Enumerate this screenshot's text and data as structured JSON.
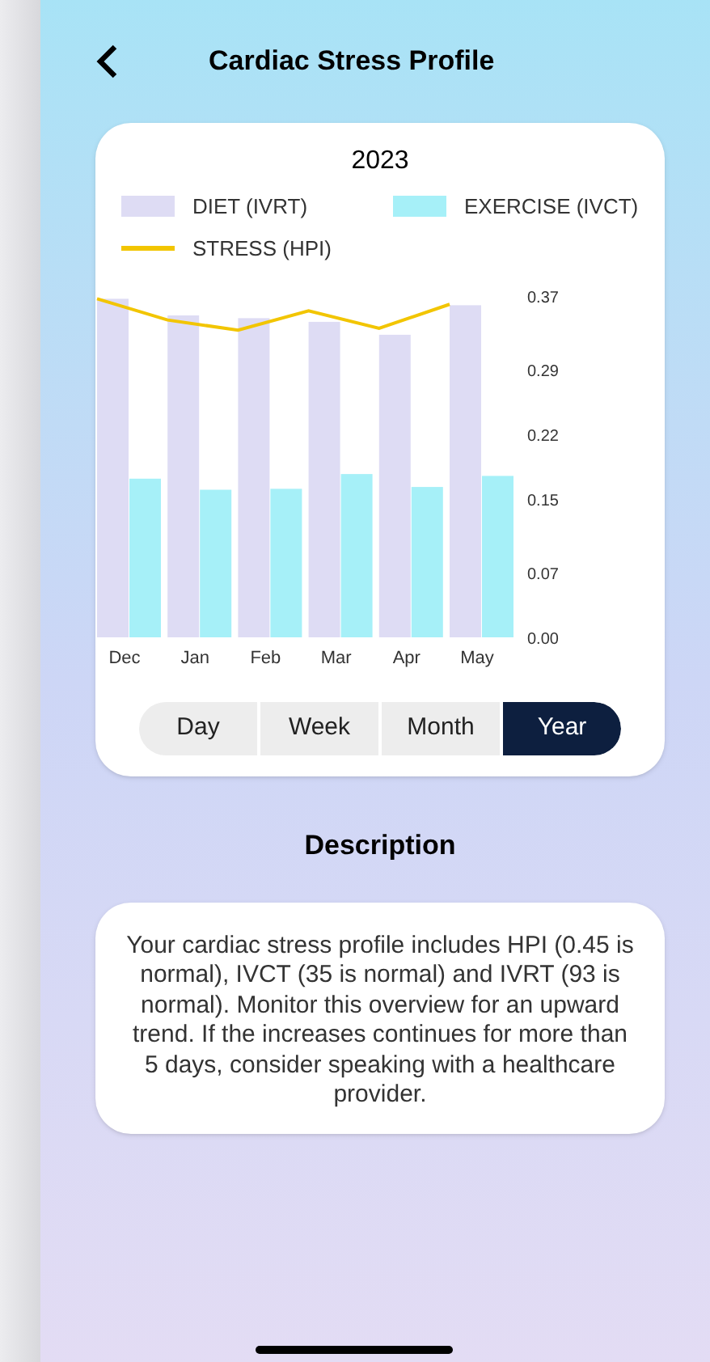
{
  "header": {
    "title": "Cardiac Stress Profile"
  },
  "chart_card": {
    "chart_data": {
      "type": "bar",
      "title": "2023",
      "categories": [
        "Dec",
        "Jan",
        "Feb",
        "Mar",
        "Apr",
        "May"
      ],
      "series": [
        {
          "name": "DIET (IVRT)",
          "color": "#dedcf4",
          "type": "bar",
          "values": [
            0.367,
            0.349,
            0.346,
            0.342,
            0.328,
            0.36
          ]
        },
        {
          "name": "EXERCISE (IVCT)",
          "color": "#a6f0f8",
          "type": "bar",
          "values": [
            0.172,
            0.16,
            0.161,
            0.177,
            0.163,
            0.175
          ]
        },
        {
          "name": "STRESS (HPI)",
          "color": "#f2c500",
          "type": "line",
          "values": [
            0.367,
            0.344,
            0.333,
            0.354,
            0.335,
            0.361
          ]
        }
      ],
      "ylim": [
        0,
        0.37
      ],
      "yticks": [
        {
          "value": 0,
          "label": "0.00"
        },
        {
          "value": 0.07,
          "label": "0.07"
        },
        {
          "value": 0.15,
          "label": "0.15"
        },
        {
          "value": 0.22,
          "label": "0.22"
        },
        {
          "value": 0.29,
          "label": "0.29"
        },
        {
          "value": 0.37,
          "label": "0.37"
        }
      ]
    },
    "periods": [
      {
        "label": "Day",
        "selected": false
      },
      {
        "label": "Week",
        "selected": false
      },
      {
        "label": "Month",
        "selected": false
      },
      {
        "label": "Year",
        "selected": true
      }
    ]
  },
  "description": {
    "heading": "Description",
    "text": "Your cardiac stress profile includes HPI (0.45 is normal), IVCT (35 is normal) and IVRT (93 is normal). Monitor this overview for an upward trend. If the increases continues for more than 5 days, consider speaking with a healthcare provider."
  }
}
